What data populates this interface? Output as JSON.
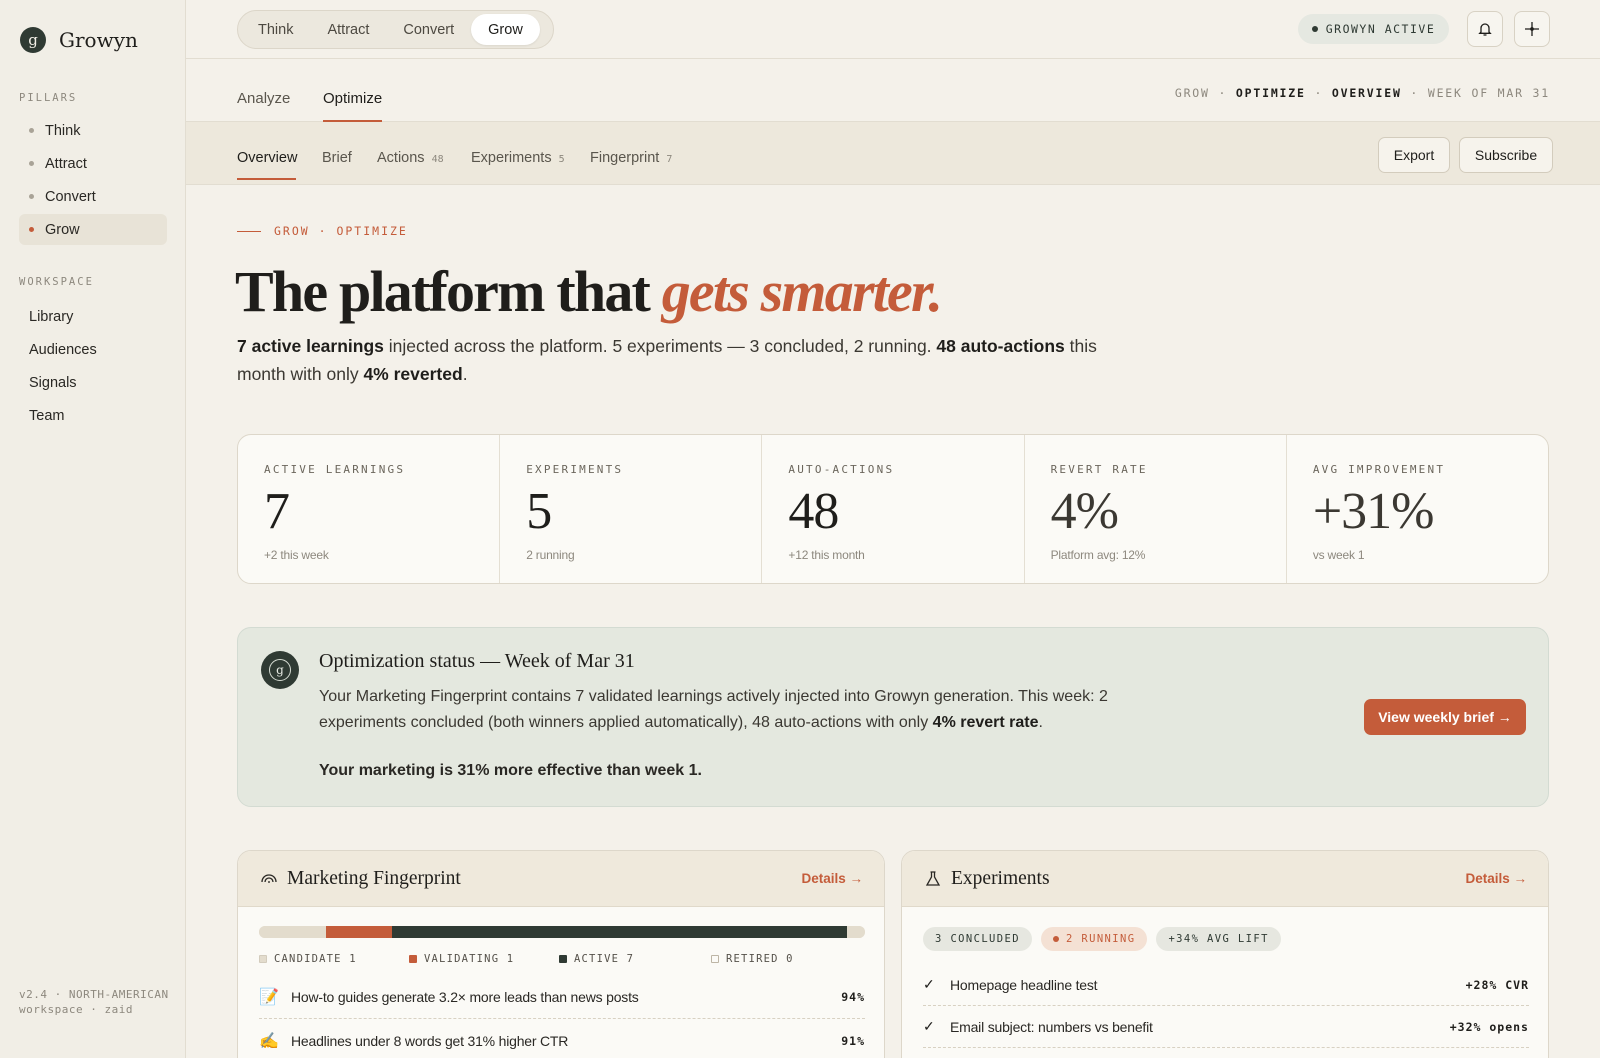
{
  "brand": {
    "mark": "g",
    "name": "Growyn"
  },
  "sidebar": {
    "pillars_title": "PILLARS",
    "pillars": [
      {
        "label": "Think"
      },
      {
        "label": "Attract"
      },
      {
        "label": "Convert"
      },
      {
        "label": "Grow",
        "active": true
      }
    ],
    "workspace_title": "WORKSPACE",
    "workspace": [
      {
        "label": "Library"
      },
      {
        "label": "Audiences"
      },
      {
        "label": "Signals"
      },
      {
        "label": "Team"
      }
    ],
    "footer": "v2.4 · NORTH-AMERICAN workspace · zaid"
  },
  "topbar": {
    "pillar_tabs": [
      "Think",
      "Attract",
      "Convert",
      "Grow"
    ],
    "active_pillar": "Grow",
    "status": "GROWYN ACTIVE"
  },
  "subnav": {
    "tabs": [
      "Analyze",
      "Optimize"
    ],
    "active": "Optimize",
    "breadcrumb": {
      "a": "GROW",
      "b": "OPTIMIZE",
      "c": "OVERVIEW",
      "d": "WEEK OF MAR 31"
    }
  },
  "tabbar": {
    "tabs": [
      {
        "label": "Overview",
        "count": ""
      },
      {
        "label": "Brief",
        "count": ""
      },
      {
        "label": "Actions",
        "count": "48"
      },
      {
        "label": "Experiments",
        "count": "5"
      },
      {
        "label": "Fingerprint",
        "count": "7"
      }
    ],
    "export_label": "Export",
    "subscribe_label": "Subscribe"
  },
  "hero": {
    "eyebrow": "GROW · OPTIMIZE",
    "title_plain": "The platform that ",
    "title_accent": "gets smarter.",
    "sub": {
      "p1b": "7 active learnings",
      "p1": " injected across the platform. 5 experiments — 3 concluded, 2 running. ",
      "p2b": "48 auto-actions",
      "p2": " this month with only ",
      "p3b": "4% reverted",
      "p3": "."
    }
  },
  "stats": [
    {
      "label": "ACTIVE LEARNINGS",
      "value": "7",
      "note": "+2 this week"
    },
    {
      "label": "EXPERIMENTS",
      "value": "5",
      "note": "2 running"
    },
    {
      "label": "AUTO-ACTIONS",
      "value": "48",
      "note": "+12 this month"
    },
    {
      "label": "REVERT RATE",
      "value": "4%",
      "note": "Platform avg: 12%"
    },
    {
      "label": "AVG IMPROVEMENT",
      "value": "+31%",
      "note": "vs week 1"
    }
  ],
  "banner": {
    "mark": "g",
    "title": "Optimization status — Week of Mar 31",
    "body": "Your Marketing Fingerprint contains 7 validated learnings actively injected into Growyn generation. This week: 2 experiments concluded (both winners applied automatically), 48 auto-actions with only ",
    "body_bold": "4% revert rate",
    "body_end": ".",
    "strong": "Your marketing is 31% more effective than week 1.",
    "button": "View weekly brief →"
  },
  "fingerprint": {
    "title": "Marketing Fingerprint",
    "link": "Details →",
    "bar": [
      {
        "name": "Candidate",
        "fraction": 0.11,
        "color": "#e3dccd"
      },
      {
        "name": "Validating",
        "fraction": 0.11,
        "color": "#c45c3a"
      },
      {
        "name": "Active",
        "fraction": 0.75,
        "color": "#2f3a33"
      },
      {
        "name": "Retired",
        "fraction": 0.03,
        "color": "#e3dccd"
      }
    ],
    "legend": [
      "CANDIDATE 1",
      "VALIDATING 1",
      "ACTIVE 7",
      "RETIRED 0"
    ],
    "rows": [
      {
        "emoji": "📝",
        "text": "How-to guides generate 3.2× more leads than news posts",
        "pct": "94%"
      },
      {
        "emoji": "✍",
        "text": "Headlines under 8 words get 31% higher CTR",
        "pct": "91%"
      }
    ]
  },
  "experiments": {
    "title": "Experiments",
    "link": "Details →",
    "chips": [
      "3 CONCLUDED",
      "2 RUNNING",
      "+34% AVG LIFT"
    ],
    "rows": [
      {
        "text": "Homepage headline test",
        "result": "+28% CVR"
      },
      {
        "text": "Email subject: numbers vs benefit",
        "result": "+32% opens"
      }
    ]
  },
  "colors": {
    "accent": "#c45c3a",
    "dark": "#2f3a33",
    "bg": "#f4f1ea"
  }
}
